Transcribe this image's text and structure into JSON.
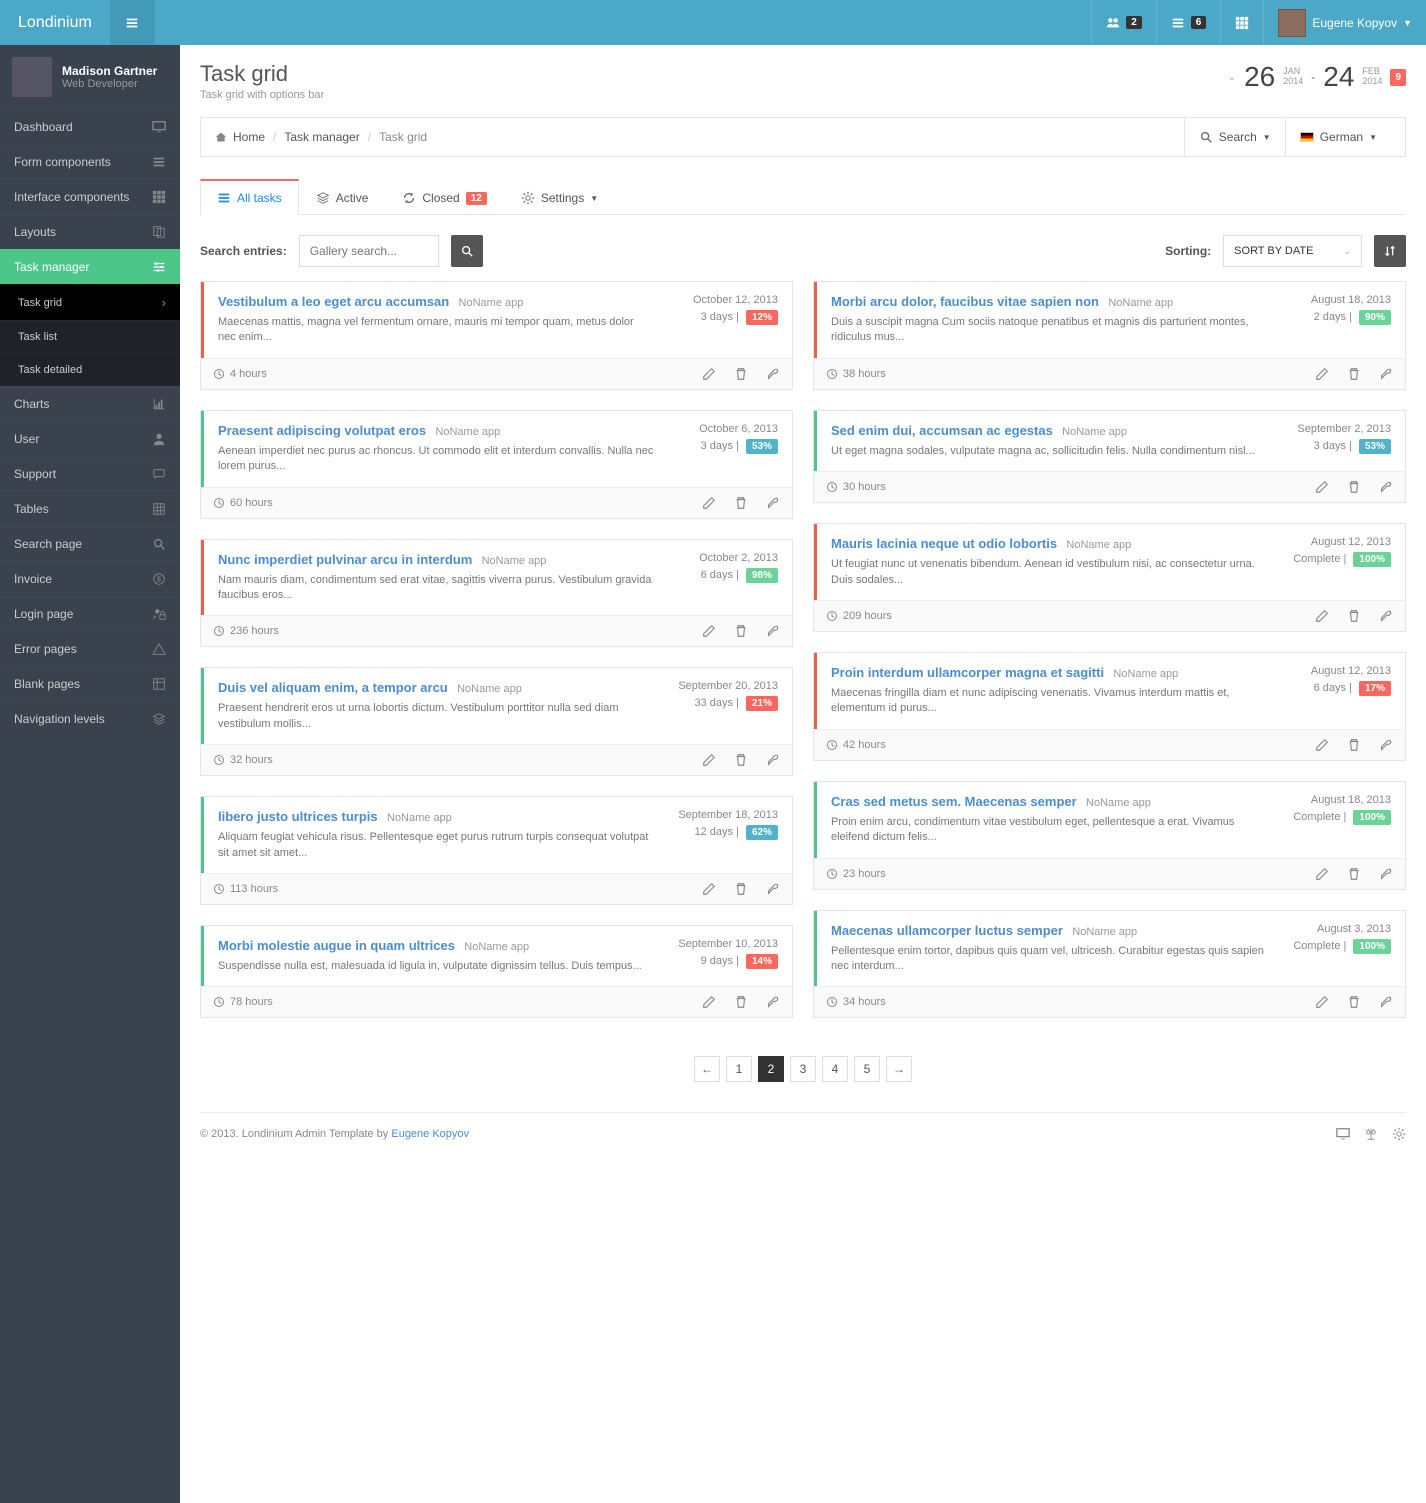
{
  "brand": "Londinium",
  "topbar": {
    "badges": {
      "a": "2",
      "b": "6"
    },
    "user": "Eugene Kopyov"
  },
  "sidebarUser": {
    "name": "Madison Gartner",
    "role": "Web Developer"
  },
  "nav": {
    "dashboard": "Dashboard",
    "forms": "Form components",
    "interface": "Interface components",
    "layouts": "Layouts",
    "taskmgr": "Task manager",
    "tgrid": "Task grid",
    "tlist": "Task list",
    "tdetail": "Task detailed",
    "charts": "Charts",
    "user": "User",
    "support": "Support",
    "tables": "Tables",
    "search": "Search page",
    "invoice": "Invoice",
    "login": "Login page",
    "error": "Error pages",
    "blank": "Blank pages",
    "navlev": "Navigation levels"
  },
  "header": {
    "title": "Task grid",
    "sub": "Task grid with options bar",
    "dateFrom": {
      "d": "26",
      "m": "JAN",
      "y": "2014"
    },
    "dateTo": {
      "d": "24",
      "m": "FEB",
      "y": "2014"
    },
    "badge": "9"
  },
  "breadcrumb": {
    "home": "Home",
    "mgr": "Task manager",
    "grid": "Task grid",
    "search": "Search",
    "lang": "German"
  },
  "tabs": {
    "all": "All tasks",
    "active": "Active",
    "closed": "Closed",
    "closedCount": "12",
    "settings": "Settings"
  },
  "controls": {
    "searchLabel": "Search entries:",
    "placeholder": "Gallery search...",
    "sortLabel": "Sorting:",
    "sortValue": "SORT BY DATE"
  },
  "tasks": {
    "left": [
      {
        "title": "Vestibulum a leo eget arcu accumsan",
        "app": "NoName app",
        "desc": "Maecenas mattis, magna vel fermentum ornare, mauris mi tempor quam, metus dolor nec enim...",
        "date": "October 12, 2013",
        "sub": "3 days |",
        "pill": "12%",
        "pillClass": "danger",
        "hours": "4 hours",
        "color": "red"
      },
      {
        "title": "Praesent adipiscing volutpat eros",
        "app": "NoName app",
        "desc": "Aenean imperdiet nec purus ac rhoncus. Ut commodo elit et interdum convallis. Nulla nec lorem purus...",
        "date": "October 6, 2013",
        "sub": "3 days |",
        "pill": "53%",
        "pillClass": "info",
        "hours": "60 hours",
        "color": "green"
      },
      {
        "title": "Nunc imperdiet pulvinar arcu in interdum",
        "app": "NoName app",
        "desc": "Nam mauris diam, condimentum sed erat vitae, sagittis viverra purus. Vestibulum gravida faucibus eros...",
        "date": "October 2, 2013",
        "sub": "6 days |",
        "pill": "98%",
        "pillClass": "success",
        "hours": "236 hours",
        "color": "red"
      },
      {
        "title": "Duis vel aliquam enim, a tempor arcu",
        "app": "NoName app",
        "desc": "Praesent hendrerit eros ut urna lobortis dictum. Vestibulum porttitor nulla sed diam vestibulum mollis...",
        "date": "September 20, 2013",
        "sub": "33 days |",
        "pill": "21%",
        "pillClass": "danger",
        "hours": "32 hours",
        "color": "green"
      },
      {
        "title": "libero justo ultrices turpis",
        "app": "NoName app",
        "desc": "Aliquam feugiat vehicula risus. Pellentesque eget purus rutrum turpis consequat volutpat sit amet sit amet...",
        "date": "September 18, 2013",
        "sub": "12 days |",
        "pill": "62%",
        "pillClass": "info",
        "hours": "113 hours",
        "color": "green"
      },
      {
        "title": "Morbi molestie augue in quam ultrices",
        "app": "NoName app",
        "desc": "Suspendisse nulla est, malesuada id ligula in, vulputate dignissim tellus. Duis tempus...",
        "date": "September 10, 2013",
        "sub": "9 days |",
        "pill": "14%",
        "pillClass": "danger",
        "hours": "78 hours",
        "color": "green"
      }
    ],
    "right": [
      {
        "title": "Morbi arcu dolor, faucibus vitae sapien non",
        "app": "NoName app",
        "desc": "Duis a suscipit magna Cum sociis natoque penatibus et magnis dis parturient montes, ridiculus mus...",
        "date": "August 18, 2013",
        "sub": "2 days |",
        "pill": "90%",
        "pillClass": "success",
        "hours": "38 hours",
        "color": "red"
      },
      {
        "title": "Sed enim dui, accumsan ac egestas",
        "app": "NoName app",
        "desc": "Ut eget magna sodales, vulputate magna ac, sollicitudin felis. Nulla condimentum nisl...",
        "date": "September 2, 2013",
        "sub": "3 days |",
        "pill": "53%",
        "pillClass": "info",
        "hours": "30 hours",
        "color": "green"
      },
      {
        "title": "Mauris lacinia neque ut odio lobortis",
        "app": "NoName app",
        "desc": "Ut feugiat nunc ut venenatis bibendum. Aenean id vestibulum nisi, ac consectetur urna. Duis sodales...",
        "date": "August 12, 2013",
        "sub": "Complete |",
        "pill": "100%",
        "pillClass": "success",
        "hours": "209 hours",
        "color": "red"
      },
      {
        "title": "Proin interdum ullamcorper magna et sagitti",
        "app": "NoName app",
        "desc": "Maecenas fringilla diam et nunc adipiscing venenatis. Vivamus interdum mattis et, elementum id purus...",
        "date": "August 12, 2013",
        "sub": "6 days |",
        "pill": "17%",
        "pillClass": "danger",
        "hours": "42 hours",
        "color": "red"
      },
      {
        "title": "Cras sed metus sem. Maecenas semper",
        "app": "NoName app",
        "desc": "Proin enim arcu, condimentum vitae vestibulum eget, pellentesque a erat. Vivamus eleifend dictum felis...",
        "date": "August 18, 2013",
        "sub": "Complete |",
        "pill": "100%",
        "pillClass": "success",
        "hours": "23 hours",
        "color": "green"
      },
      {
        "title": "Maecenas ullamcorper luctus semper",
        "app": "NoName app",
        "desc": "Pellentesque enim tortor, dapibus quis quam vel, ultricesh. Curabitur egestas quis sapien nec interdum...",
        "date": "August 3, 2013",
        "sub": "Complete |",
        "pill": "100%",
        "pillClass": "success",
        "hours": "34 hours",
        "color": "green"
      }
    ]
  },
  "pagination": [
    "1",
    "2",
    "3",
    "4",
    "5"
  ],
  "footer": {
    "text": "© 2013. Londinium Admin Template by ",
    "author": "Eugene Kopyov"
  }
}
